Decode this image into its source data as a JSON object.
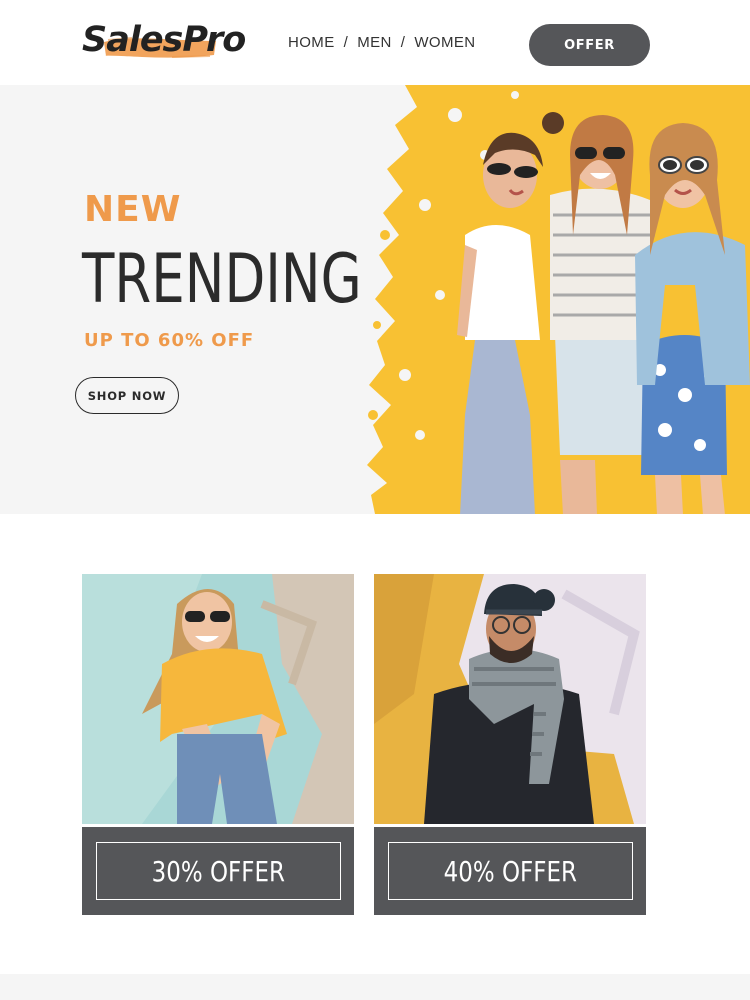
{
  "header": {
    "logo_text": "SalesPro",
    "nav": {
      "home": "HOME",
      "men": "MEN",
      "women": "WOMEN",
      "separator": "/"
    },
    "offer_label": "OFFER"
  },
  "hero": {
    "eyebrow": "NEW",
    "title": "TRENDING",
    "subtitle": "UP TO 60% OFF",
    "cta_label": "SHOP NOW",
    "image_icon": "three-women-photo"
  },
  "promos": [
    {
      "label": "30% OFFER",
      "image_icon": "woman-yellow-shirt-photo"
    },
    {
      "label": "40% OFFER",
      "image_icon": "man-beanie-scarf-photo"
    }
  ],
  "colors": {
    "accent": "#ef9a4b",
    "dark_button": "#555659",
    "hero_background": "#f5f5f5",
    "hero_art_yellow": "#f8c133",
    "text_dark": "#2b2b2b"
  }
}
